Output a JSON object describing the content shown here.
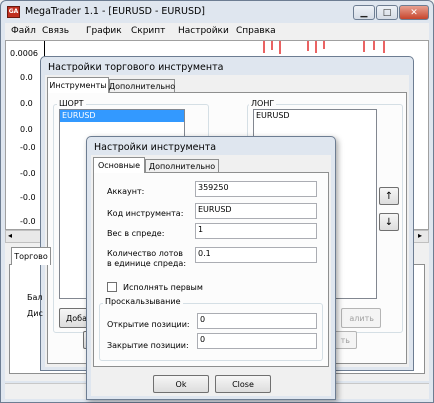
{
  "main_window": {
    "title": "MegaTrader 1.1 - [EURUSD - EURUSD]",
    "menu": [
      "Файл",
      "Связь",
      "График",
      "Скрипт",
      "Настройки",
      "Справка"
    ],
    "chart_y_labels": [
      "0.0006",
      "0.0",
      "0.0",
      "0.0",
      "-0.0",
      "-0.0",
      "-0.0",
      "-0.0"
    ],
    "lower_tab": "Торгово",
    "lower_labels": [
      "Бал",
      "Дис"
    ],
    "lower_button": "Доба"
  },
  "settings_dialog": {
    "title": "Настройки торгового инструмента",
    "tabs": [
      "Инструменты",
      "Дополнительно"
    ],
    "short_group": "ШОРТ",
    "long_group": "ЛОНГ",
    "short_items": [
      "EURUSD"
    ],
    "long_items": [
      "EURUSD"
    ],
    "remove_button_partial": "алить",
    "second_button_partial": "ть",
    "up_arrow": "↑",
    "down_arrow": "↓"
  },
  "instrument_dialog": {
    "title": "Настройки инструмента",
    "tabs": [
      "Основные",
      "Дополнительно"
    ],
    "fields": {
      "account_label": "Аккаунт:",
      "account_value": "359250",
      "code_label": "Код инструмента:",
      "code_value": "EURUSD",
      "spread_weight_label": "Вес в спреде:",
      "spread_weight_value": "1",
      "lots_label_line1": "Количество лотов",
      "lots_label_line2": "в единице спреда:",
      "lots_value": "0.1"
    },
    "execute_first_label": "Исполнять первым",
    "execute_first_checked": false,
    "slippage_group": "Проскальзывание",
    "open_label": "Открытие позиции:",
    "open_value": "0",
    "close_label": "Закрытие позиции:",
    "close_value": "0",
    "ok_button": "Ok",
    "close_button": "Close"
  },
  "colors": {
    "title_frame": "#dfe6ef",
    "selection": "#3399ff",
    "chart_red": "#e02020"
  }
}
